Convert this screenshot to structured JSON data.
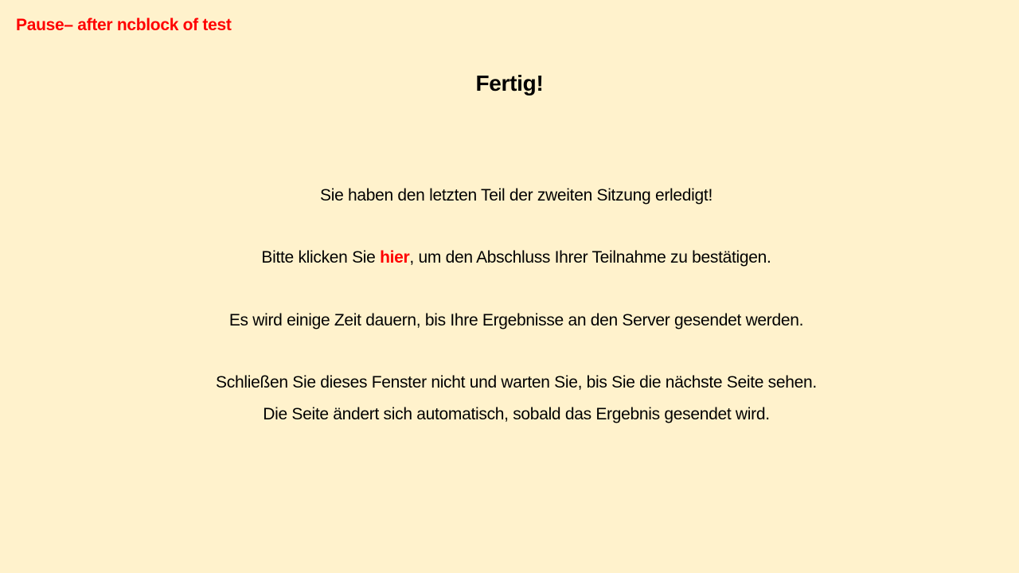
{
  "slide_label": "Pause– after ncblock of test",
  "title": "Fertig!",
  "messages": {
    "completed": "Sie haben den letzten Teil der zweiten Sitzung erledigt!",
    "click_prefix": "Bitte klicken Sie ",
    "click_link": "hier",
    "click_suffix": ", um den Abschluss Ihrer Teilnahme zu bestätigen.",
    "wait_time": "Es wird einige Zeit dauern, bis Ihre Ergebnisse an den Server gesendet werden.",
    "do_not_close": "Schließen Sie dieses Fenster nicht und warten Sie, bis Sie die nächste Seite sehen.",
    "auto_change": "Die Seite ändert sich automatisch, sobald das Ergebnis gesendet wird."
  },
  "colors": {
    "background": "#FFF2CC",
    "accent": "#FF0000",
    "text": "#000000"
  }
}
